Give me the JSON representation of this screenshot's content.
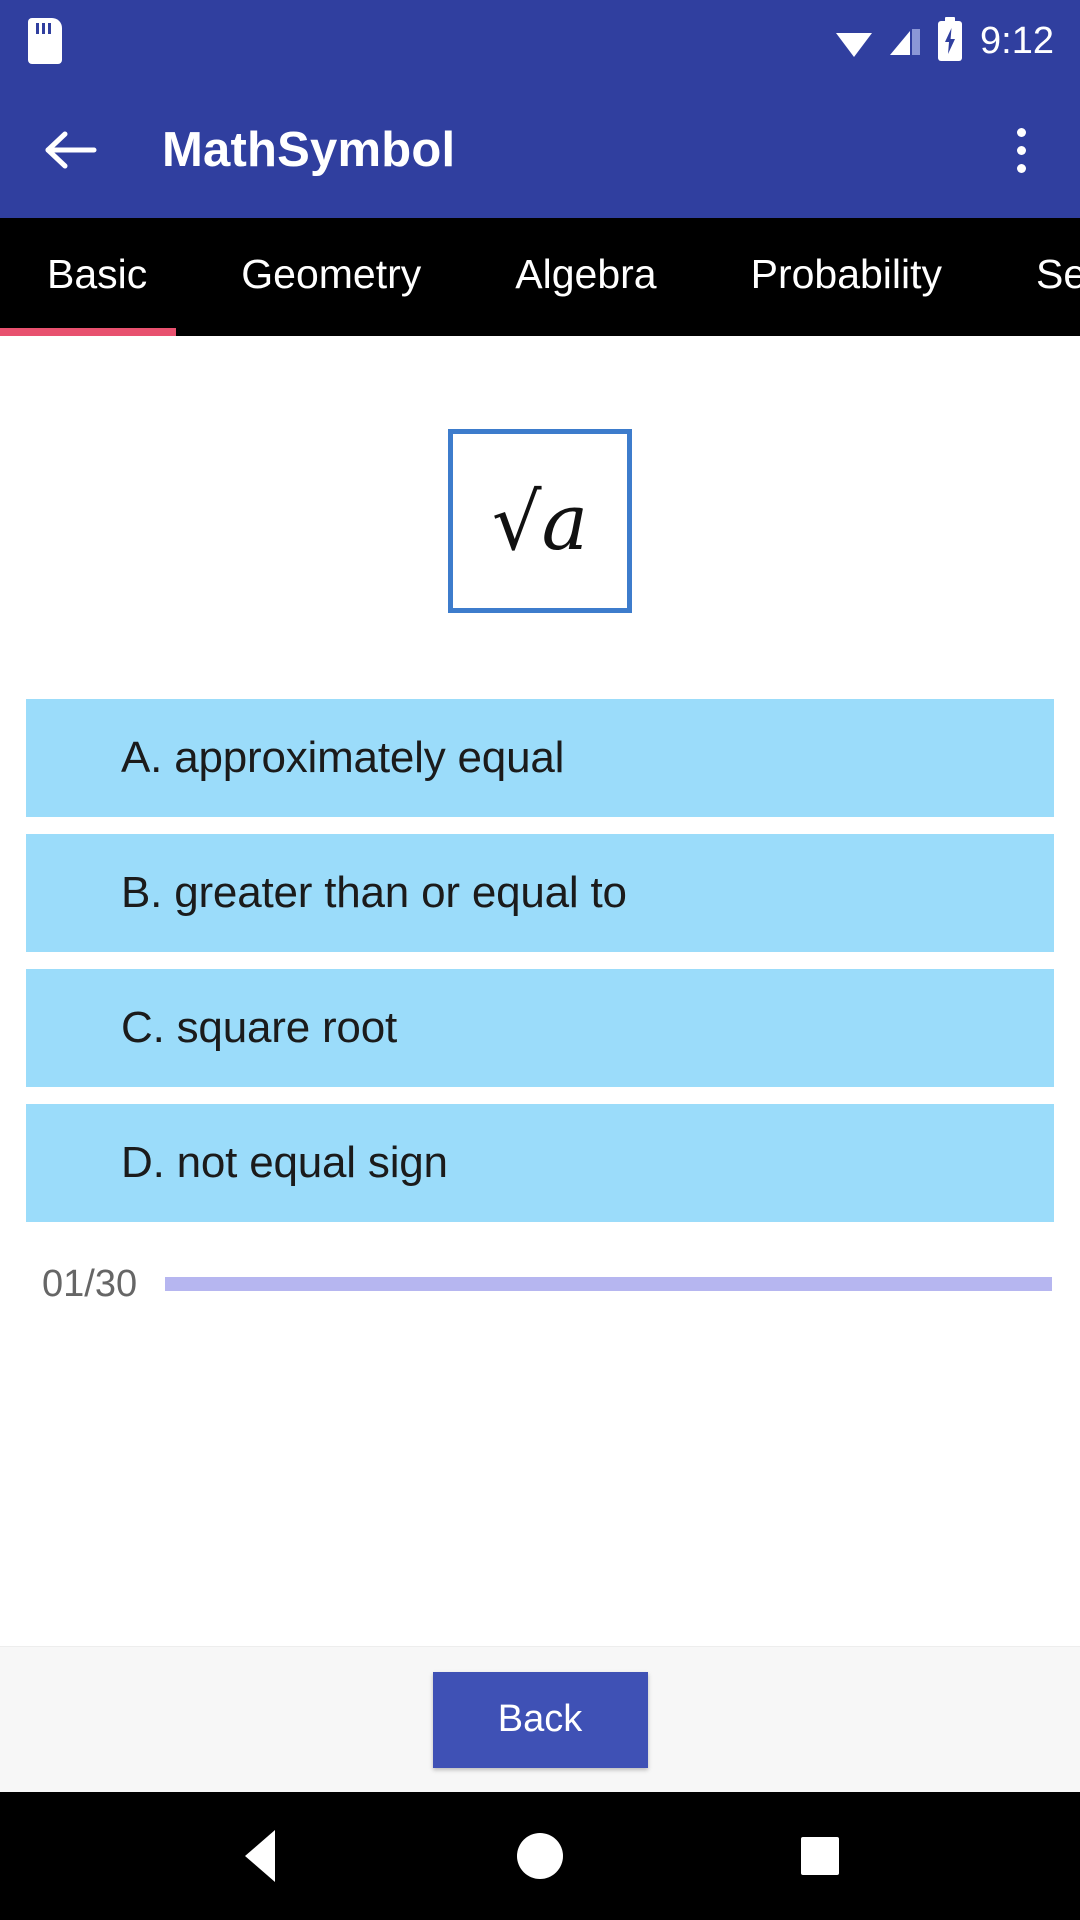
{
  "status_bar": {
    "time": "9:12",
    "icons": [
      "sd-card-icon",
      "wifi-icon",
      "cellular-signal-icon",
      "battery-charging-icon"
    ]
  },
  "app_bar": {
    "title": "MathSymbol",
    "back_icon": "arrow-left-icon",
    "overflow_icon": "more-vertical-icon"
  },
  "tabs": {
    "selected_index": 0,
    "items": [
      {
        "label": "Basic"
      },
      {
        "label": "Geometry"
      },
      {
        "label": "Algebra"
      },
      {
        "label": "Probability"
      },
      {
        "label": "Se"
      }
    ],
    "indicator_color": "#e8516f"
  },
  "question": {
    "symbol": "√a",
    "symbol_border_color": "#3d7ccc",
    "options": [
      {
        "label": "A. approximately equal"
      },
      {
        "label": "B. greater than or equal to"
      },
      {
        "label": "C. square root"
      },
      {
        "label": "D. not equal sign"
      }
    ],
    "option_bg_color": "#9bdcfa"
  },
  "progress": {
    "count_label": "01/30",
    "current": 1,
    "total": 30,
    "track_color": "#b6b6f0"
  },
  "footer": {
    "back_label": "Back",
    "button_color": "#3f51b5"
  },
  "nav_bar": {
    "back_icon": "nav-back-triangle-icon",
    "home_icon": "nav-home-circle-icon",
    "recents_icon": "nav-recents-square-icon"
  }
}
